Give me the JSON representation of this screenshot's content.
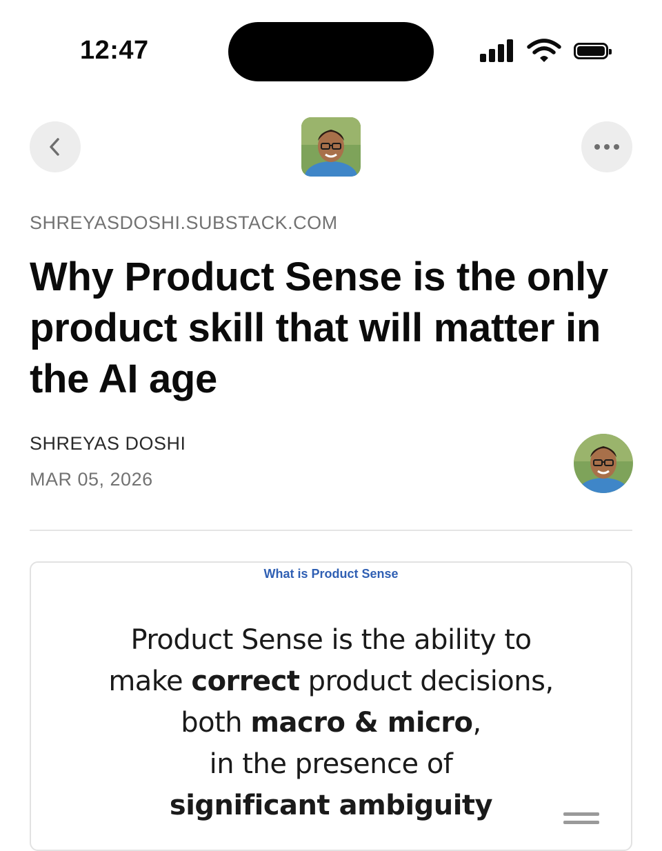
{
  "status_bar": {
    "time": "12:47"
  },
  "nav": {
    "back_icon": "chevron-left-icon",
    "more_icon": "ellipsis-icon"
  },
  "article": {
    "publication": "SHREYASDOSHI.SUBSTACK.COM",
    "title": "Why Product Sense is the only product skill that will matter in the AI age",
    "author": "SHREYAS DOSHI",
    "date": "MAR 05, 2026"
  },
  "image_card": {
    "title": "What is Product Sense",
    "lines": [
      {
        "parts": [
          {
            "text": "Product Sense is the ability to",
            "bold": false
          }
        ]
      },
      {
        "parts": [
          {
            "text": "make ",
            "bold": false
          },
          {
            "text": "correct",
            "bold": true
          },
          {
            "text": " product decisions,",
            "bold": false
          }
        ]
      },
      {
        "parts": [
          {
            "text": "both ",
            "bold": false
          },
          {
            "text": "macro & micro",
            "bold": true
          },
          {
            "text": ",",
            "bold": false
          }
        ]
      },
      {
        "parts": [
          {
            "text": "in the presence of",
            "bold": false
          }
        ]
      },
      {
        "parts": [
          {
            "text": "significant ambiguity",
            "bold": true
          }
        ]
      }
    ]
  },
  "colors": {
    "accent_blue": "#2f5fb3",
    "muted_text": "#727272",
    "button_bg": "#ededed"
  }
}
